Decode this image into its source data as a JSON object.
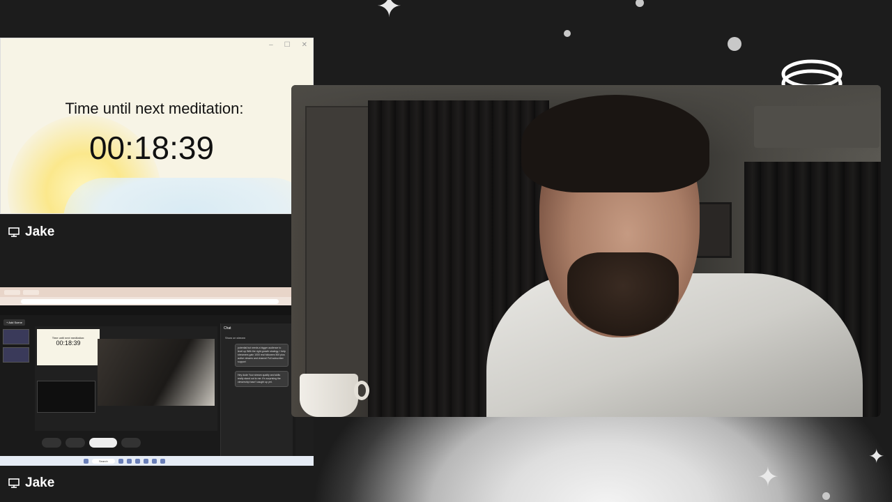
{
  "timer_window": {
    "title": "Time until next meditation:",
    "value": "00:18:39",
    "controls": [
      "–",
      "☐",
      "✕"
    ]
  },
  "participants": [
    {
      "name": "Jake",
      "icon": "monitor-icon"
    },
    {
      "name": "Jake",
      "icon": "monitor-icon"
    }
  ],
  "screen_share": {
    "add_scene_label": "+ Add Scene",
    "mini_timer_title": "Time until next meditation:",
    "mini_timer_value": "00:18:39",
    "chat_title": "Chat",
    "chat_show_on_stream": "Show on stream",
    "chat_message_1": "potential but needs a bigger audience to level up With the right growth strategy, I help streamers gain 1000 real followers 500 plus active viewers and channel Full subscriber support",
    "chat_message_2": "Hey dude Your stream quality and skills really stand out to me. It's surprising the viewership hasn't caught up yet.",
    "taskbar_search": "Search"
  },
  "colors": {
    "background": "#1c1c1c",
    "timer_bg": "#f7f4e6",
    "text_light": "#ffffff"
  }
}
